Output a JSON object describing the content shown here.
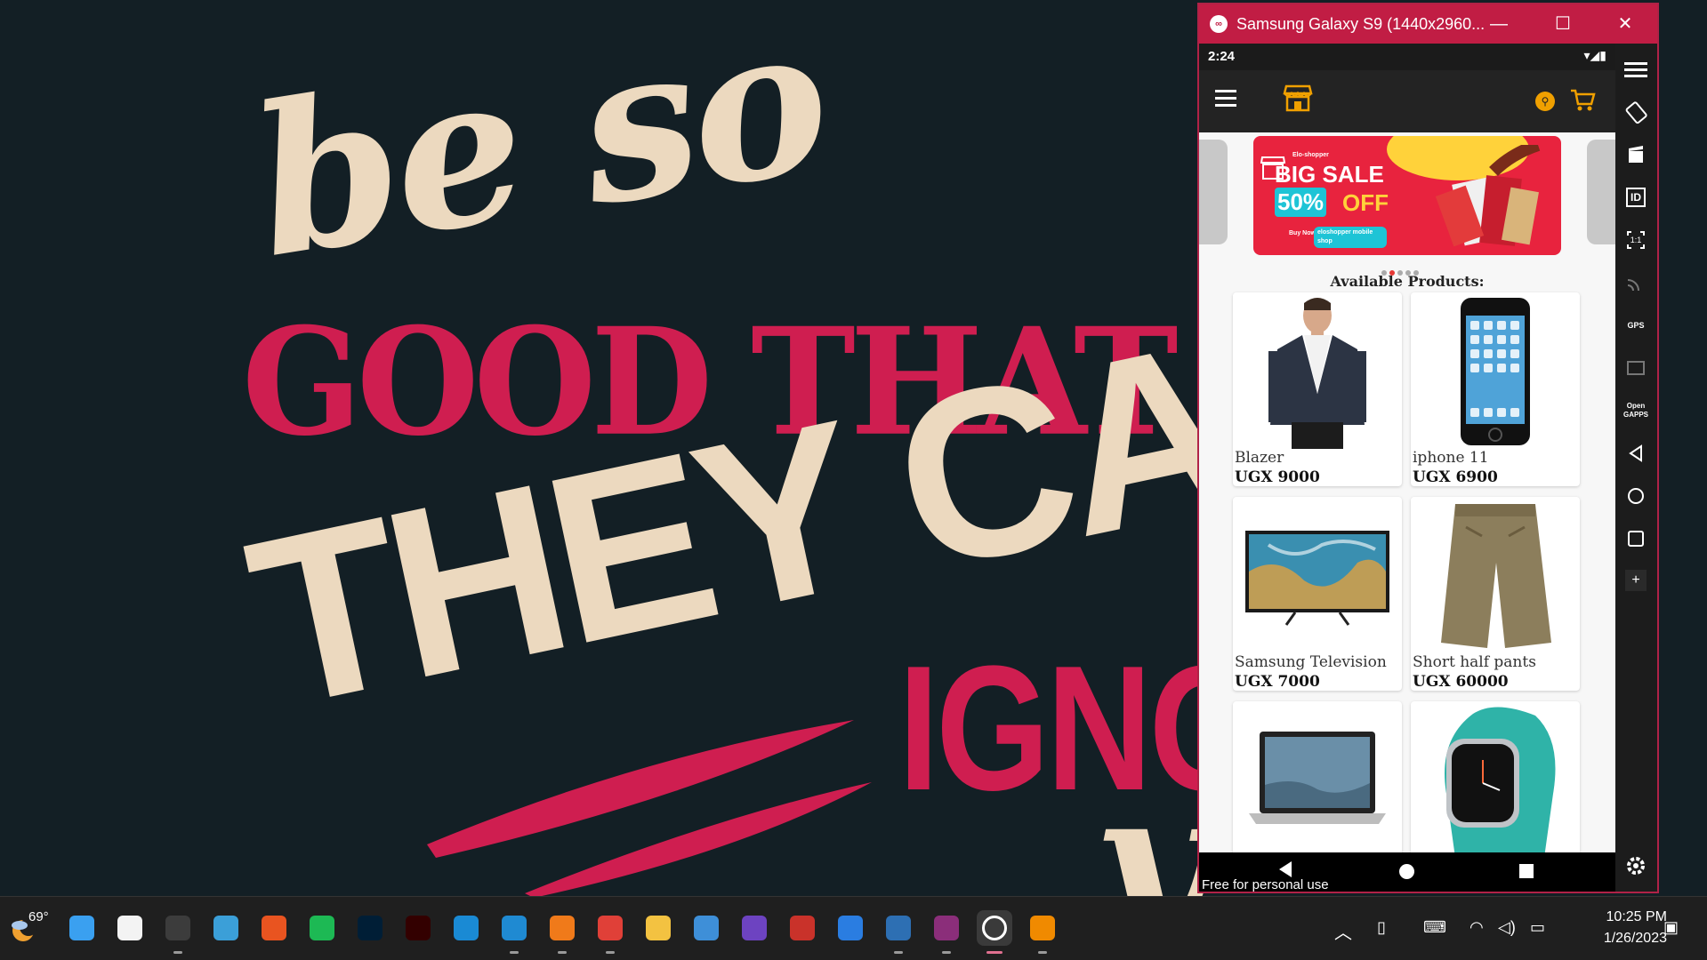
{
  "wallpaper": {
    "line1": "be so",
    "line2": "GOOD THAT",
    "line3": "THEY CA",
    "line4": "IGNO",
    "line5": "y"
  },
  "emulator": {
    "title": "Samsung Galaxy S9 (1440x2960...",
    "minimize_label": "—",
    "maximize_label": "☐",
    "close_label": "✕",
    "status_time": "2:24",
    "status_icons": "▾◢▮",
    "banner": {
      "brand": "Elo-shopper",
      "big_sale": "BIG SALE",
      "percent": "50%",
      "off": "OFF",
      "buy_now": "Buy Now",
      "shop_tag": "eloshopper mobile shop"
    },
    "section_title": "Available Products:",
    "products": [
      {
        "name": "Blazer",
        "price": "UGX 9000"
      },
      {
        "name": "iphone 11",
        "price": "UGX 6900"
      },
      {
        "name": "Samsung Television",
        "price": "UGX 7000"
      },
      {
        "name": "Short half pants",
        "price": "UGX 60000"
      },
      {
        "name": "",
        "price": ""
      },
      {
        "name": "",
        "price": ""
      }
    ],
    "watermark": "Free for personal use",
    "sidebar_labels": [
      "ID",
      "1:1",
      "GPS",
      "Open GAPPS",
      "+"
    ]
  },
  "taskbar": {
    "weather_temp": "69°",
    "apps": [
      "start-icon",
      "store-icon",
      "terminal-icon",
      "teams-icon",
      "ubuntu-icon",
      "spotify-icon",
      "photoshop-icon",
      "illustrator-icon",
      "edge-icon",
      "vscode-icon",
      "search-tool-icon",
      "chrome-icon",
      "files-icon",
      "headphones-icon",
      "visual-studio-icon",
      "psiphon-icon",
      "todo-icon",
      "virtualbox-icon",
      "genymotion-icon",
      "genymotion-active-icon",
      "vlc-icon"
    ],
    "time": "10:25 PM",
    "date": "1/26/2023",
    "colors": {
      "bg": "#1f1f1f",
      "accent": "#c11d44"
    }
  }
}
